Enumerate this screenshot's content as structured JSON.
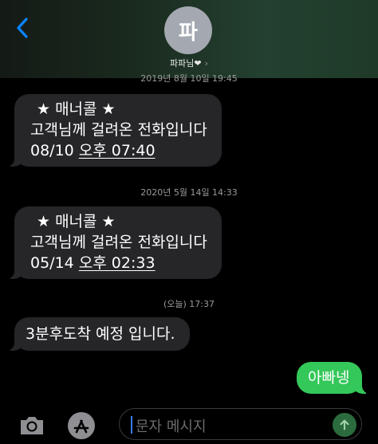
{
  "header": {
    "avatar_initial": "파",
    "contact_name": "파파님❤",
    "chevron": "›"
  },
  "messages": [
    {
      "type": "timestamp",
      "text": "2019년 8월 10일 19:45"
    },
    {
      "type": "incoming",
      "lines": [
        "★ 매너콜 ★",
        "고객님께 걸려온 전화입니다"
      ],
      "date": "08/10",
      "time": "오후 07:40"
    },
    {
      "type": "timestamp",
      "text": "2020년 5월 14일 14:33"
    },
    {
      "type": "incoming",
      "lines": [
        "★ 매너콜 ★",
        "고객님께 걸려온 전화입니다"
      ],
      "date": "05/14",
      "time": "오후 02:33"
    },
    {
      "type": "timestamp",
      "text": "(오늘) 17:37"
    },
    {
      "type": "incoming",
      "lines": [
        "3분후도착 예정 입니다."
      ]
    },
    {
      "type": "outgoing",
      "lines": [
        "아빠넹"
      ]
    }
  ],
  "composer": {
    "placeholder": "문자 메시지"
  },
  "icons": {
    "back": "chevron-left-icon",
    "camera": "camera-icon",
    "apps": "app-store-icon",
    "send": "arrow-up-icon"
  },
  "colors": {
    "accent": "#0a84ff",
    "incoming_bubble": "#262629",
    "outgoing_bubble": "#34c759",
    "background": "#000000"
  }
}
